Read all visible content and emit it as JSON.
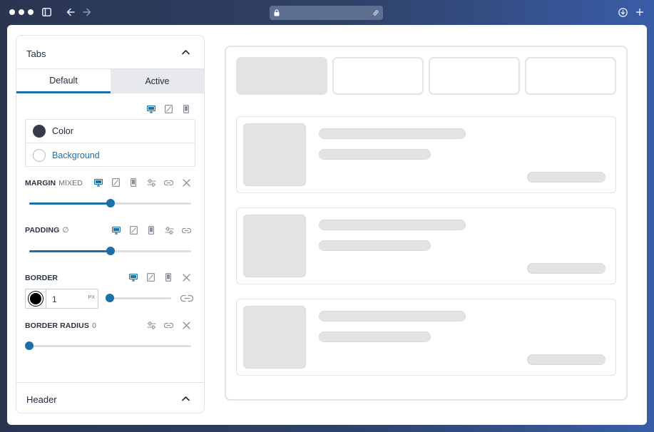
{
  "panel": {
    "title": "Tabs",
    "tabs": [
      {
        "label": "Default",
        "selected": true
      },
      {
        "label": "Active",
        "selected": false
      }
    ],
    "colors": [
      {
        "label": "Color",
        "swatch": "#363c4a"
      },
      {
        "label": "Background",
        "swatch": "#ffffff"
      }
    ],
    "margin": {
      "label": "MARGIN",
      "sub": "MIXED",
      "value_fraction": 0.5
    },
    "padding": {
      "label": "PADDING",
      "sub": "∅",
      "value_fraction": 0.5
    },
    "border": {
      "label": "BORDER",
      "width_value": "1",
      "unit": "PX",
      "swatch": "#000000",
      "value_fraction": 0.0
    },
    "border_radius": {
      "label": "BORDER RADIUS",
      "sub": "0",
      "value_fraction": 0.0
    },
    "header_section": {
      "title": "Header"
    }
  },
  "colors": {
    "accent": "#1d6fa8",
    "link": "#1d72aa"
  }
}
